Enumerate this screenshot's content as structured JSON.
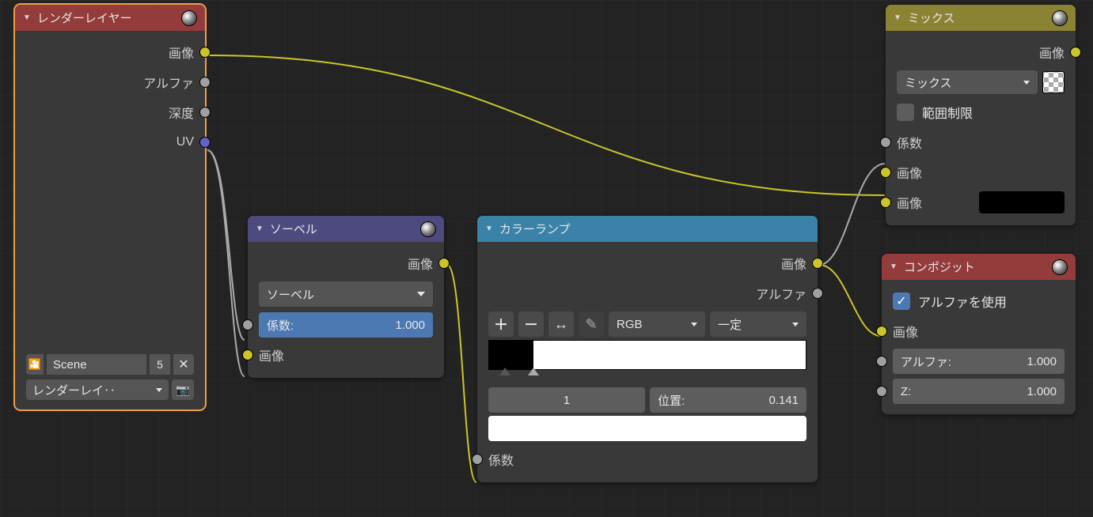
{
  "nodes": {
    "render_layers": {
      "title": "レンダーレイヤー",
      "out_image": "画像",
      "out_alpha": "アルファ",
      "out_depth": "深度",
      "out_uv": "UV",
      "scene_name": "Scene",
      "scene_users": "5",
      "layer_select": "レンダーレイ‥"
    },
    "sobel": {
      "title": "ソーベル",
      "out_image": "画像",
      "type_select": "ソーベル",
      "fac_label": "係数:",
      "fac_value": "1.000",
      "in_image": "画像"
    },
    "color_ramp": {
      "title": "カラーランプ",
      "out_image": "画像",
      "out_alpha": "アルファ",
      "colorspace": "RGB",
      "interpolation": "一定",
      "stop_index": "1",
      "pos_label": "位置:",
      "pos_value": "0.141",
      "in_fac": "係数",
      "stop0_pos": 0.05,
      "stop1_pos": 0.141
    },
    "mix": {
      "title": "ミックス",
      "out_image": "画像",
      "blend_select": "ミックス",
      "clamp_label": "範囲制限",
      "in_fac": "係数",
      "in_image1": "画像",
      "in_image2": "画像"
    },
    "composite": {
      "title": "コンポジット",
      "use_alpha": "アルファを使用",
      "in_image": "画像",
      "in_alpha_label": "アルファ:",
      "in_alpha_value": "1.000",
      "in_z_label": "Z:",
      "in_z_value": "1.000"
    }
  },
  "glyphs": {
    "tri_down": "▼",
    "plus": "＋",
    "minus": "－",
    "arrows": "↔",
    "dropper": "✎",
    "close": "✕",
    "chevdown": "⌄",
    "camera": "📷",
    "cube": "🎦",
    "check": "✓"
  },
  "colors": {
    "header_red": "#943b3b",
    "header_purple": "#4d4a80",
    "header_blue": "#3b82a8",
    "header_olive": "#8b8334",
    "socket_yellow": "#ccc529",
    "socket_gray": "#a0a0a0",
    "socket_blue": "#6363c7"
  }
}
